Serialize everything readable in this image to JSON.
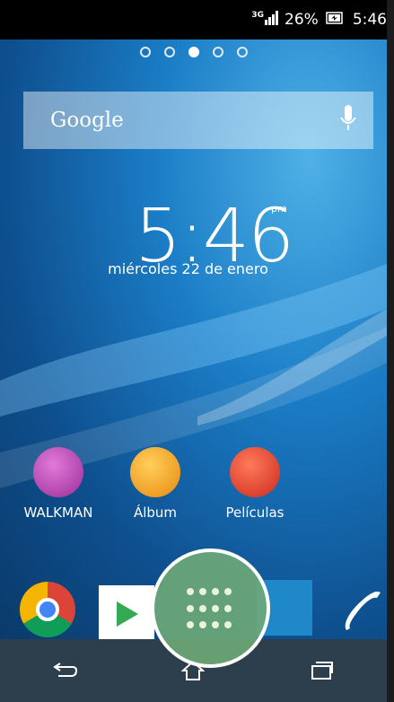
{
  "status": {
    "network": "3G",
    "battery": "26%",
    "time": "5:46"
  },
  "pages": {
    "count": 5,
    "active": 2
  },
  "search": {
    "brand": "Google"
  },
  "clock": {
    "time": "5:46",
    "ampm": "pm",
    "date": "miércoles 22 de enero"
  },
  "apps": [
    {
      "label": "WALKMAN",
      "icon": "walkman-icon",
      "color": "#b33aa7"
    },
    {
      "label": "Álbum",
      "icon": "album-icon",
      "color": "#f29a1b"
    },
    {
      "label": "Películas",
      "icon": "movies-icon",
      "color": "#e03a2a"
    }
  ],
  "dock": [
    "chrome-icon",
    "play-store-icon",
    "app-drawer-icon",
    "sony-apps-icon",
    "phone-icon"
  ],
  "navbar": [
    "back-icon",
    "home-icon",
    "recent-apps-icon"
  ]
}
